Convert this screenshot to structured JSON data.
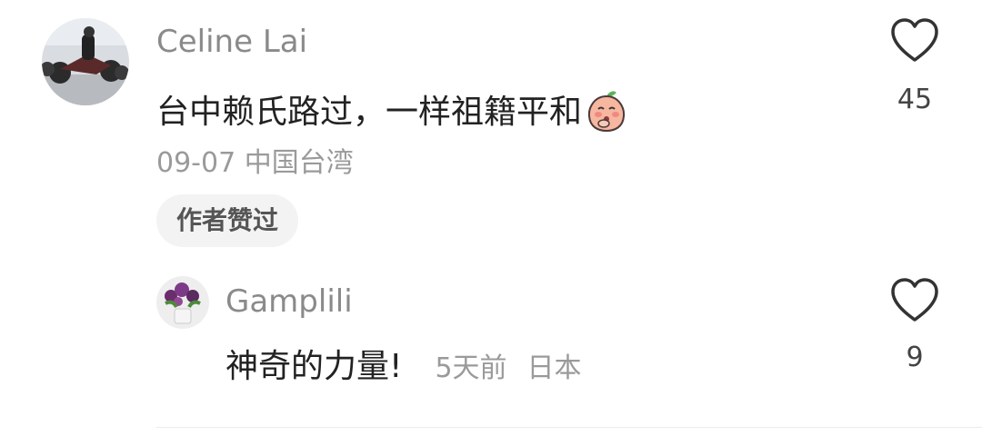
{
  "comments": [
    {
      "username": "Celine Lai",
      "avatar": "motorcycle-photo-avatar",
      "text": "台中赖氏路过，一样祖籍平和",
      "emoji": "peach-face-emoji",
      "meta": "09-07 中国台湾",
      "badge": "作者赞过",
      "likes": "45",
      "like_icon": "heart-outline-icon"
    }
  ],
  "replies": [
    {
      "username": "Gamplili",
      "avatar": "flowers-photo-avatar",
      "text": "神奇的力量!",
      "time": "5天前",
      "location": "日本",
      "likes": "9",
      "like_icon": "heart-outline-icon"
    }
  ],
  "colors": {
    "username": "#8a8a8a",
    "text": "#222222",
    "meta": "#9a9a9a",
    "badge_bg": "#f3f3f3",
    "heart_stroke": "#333333"
  }
}
